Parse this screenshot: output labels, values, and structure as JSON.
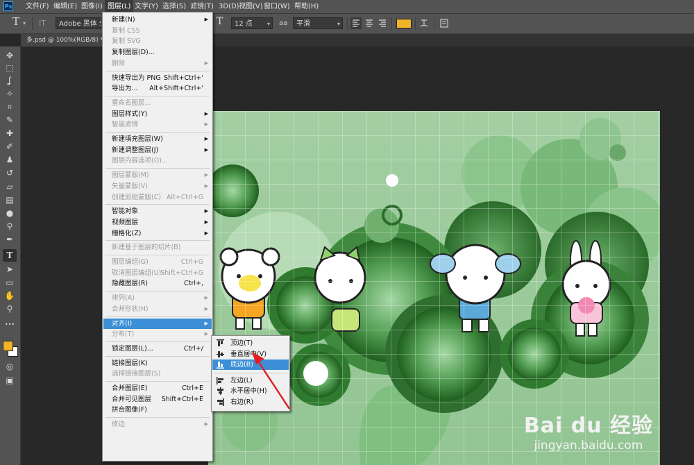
{
  "app": {
    "logo": "Ps"
  },
  "menubar": {
    "items": [
      "文件(F)",
      "编辑(E)",
      "图像(I)",
      "图层(L)",
      "文字(Y)",
      "选择(S)",
      "滤镜(T)",
      "3D(D)",
      "视图(V)",
      "窗口(W)",
      "帮助(H)"
    ],
    "active": "图层(L)"
  },
  "options": {
    "tool_icon": "T",
    "orient_icon": "IT",
    "font_family": "Adobe 黑体 Std",
    "size_icon": "T",
    "font_size": "12 点",
    "aa_icon": "aa",
    "anti_alias": "平滑",
    "text_color": "#f0b429"
  },
  "document": {
    "tab_title": "多.psd @ 100%(RGB/8) *"
  },
  "layer_menu": [
    {
      "label": "新建(N)",
      "arrow": true
    },
    {
      "label": "复制 CSS",
      "disabled": true
    },
    {
      "label": "复制 SVG",
      "disabled": true
    },
    {
      "label": "复制图层(D)..."
    },
    {
      "label": "删除",
      "disabled": true,
      "arrow": true
    },
    {
      "sep": true
    },
    {
      "label": "快速导出为 PNG",
      "shortcut": "Shift+Ctrl+'"
    },
    {
      "label": "导出为...",
      "shortcut": "Alt+Shift+Ctrl+'"
    },
    {
      "sep": true
    },
    {
      "label": "重命名图层...",
      "disabled": true
    },
    {
      "label": "图层样式(Y)",
      "arrow": true
    },
    {
      "label": "智能滤镜",
      "disabled": true,
      "arrow": true
    },
    {
      "sep": true
    },
    {
      "label": "新建填充图层(W)",
      "arrow": true
    },
    {
      "label": "新建调整图层(J)",
      "arrow": true
    },
    {
      "label": "图层内容选项(O)...",
      "disabled": true
    },
    {
      "sep": true
    },
    {
      "label": "图层蒙版(M)",
      "disabled": true,
      "arrow": true
    },
    {
      "label": "矢量蒙版(V)",
      "disabled": true,
      "arrow": true
    },
    {
      "label": "创建剪贴蒙版(C)",
      "disabled": true,
      "shortcut": "Alt+Ctrl+G"
    },
    {
      "sep": true
    },
    {
      "label": "智能对象",
      "arrow": true
    },
    {
      "label": "视频图层",
      "arrow": true
    },
    {
      "label": "栅格化(Z)",
      "arrow": true
    },
    {
      "sep": true
    },
    {
      "label": "新建基于图层的切片(B)",
      "disabled": true
    },
    {
      "sep": true
    },
    {
      "label": "图层编组(G)",
      "disabled": true,
      "shortcut": "Ctrl+G"
    },
    {
      "label": "取消图层编组(U)",
      "disabled": true,
      "shortcut": "Shift+Ctrl+G"
    },
    {
      "label": "隐藏图层(R)",
      "shortcut": "Ctrl+,"
    },
    {
      "sep": true
    },
    {
      "label": "排列(A)",
      "disabled": true,
      "arrow": true
    },
    {
      "label": "合并形状(H)",
      "disabled": true,
      "arrow": true
    },
    {
      "sep": true
    },
    {
      "label": "对齐(I)",
      "arrow": true,
      "highlight": true
    },
    {
      "label": "分布(T)",
      "disabled": true,
      "arrow": true
    },
    {
      "sep": true
    },
    {
      "label": "锁定图层(L)...",
      "shortcut": "Ctrl+/"
    },
    {
      "sep": true
    },
    {
      "label": "链接图层(K)"
    },
    {
      "label": "选择链接图层(S)",
      "disabled": true
    },
    {
      "sep": true
    },
    {
      "label": "合并图层(E)",
      "shortcut": "Ctrl+E"
    },
    {
      "label": "合并可见图层",
      "shortcut": "Shift+Ctrl+E"
    },
    {
      "label": "拼合图像(F)"
    },
    {
      "sep": true
    },
    {
      "label": "修边",
      "disabled": true,
      "arrow": true
    }
  ],
  "align_submenu": [
    {
      "label": "顶边(T)",
      "icon": "align-top-icon"
    },
    {
      "label": "垂直居中(V)",
      "icon": "align-vertical-center-icon"
    },
    {
      "label": "底边(B)",
      "icon": "align-bottom-icon",
      "highlight": true
    },
    {
      "sep": true
    },
    {
      "label": "左边(L)",
      "icon": "align-left-icon"
    },
    {
      "label": "水平居中(H)",
      "icon": "align-horizontal-center-icon"
    },
    {
      "label": "右边(R)",
      "icon": "align-right-icon"
    }
  ],
  "toolbar": [
    "move-icon",
    "marquee-icon",
    "lasso-icon",
    "magic-wand-icon",
    "crop-icon",
    "eyedropper-icon",
    "healing-brush-icon",
    "brush-icon",
    "stamp-icon",
    "history-brush-icon",
    "eraser-icon",
    "gradient-icon",
    "blur-icon",
    "dodge-icon",
    "pen-icon",
    "type-icon",
    "path-select-icon",
    "shape-icon",
    "hand-icon",
    "zoom-icon",
    "more-icon"
  ],
  "colors": {
    "foreground": "#f0b429",
    "background": "#ffffff",
    "highlight": "#3c8fd6",
    "canvas_bg": "#9ccb9c"
  },
  "watermark": {
    "brand": "Bai du 经验",
    "url": "jingyan.baidu.com"
  }
}
